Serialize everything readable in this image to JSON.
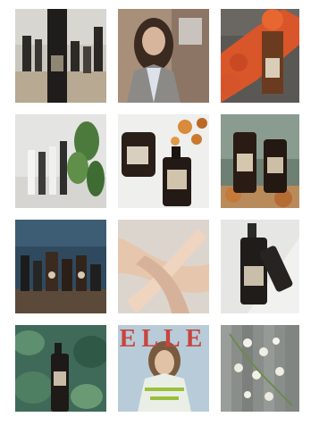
{
  "grid": {
    "tiles": [
      {
        "alt": "oil-bottles-shop-shelf"
      },
      {
        "alt": "woman-portrait"
      },
      {
        "alt": "bottle-with-orange-flowers"
      },
      {
        "alt": "tubes-and-green-leaves"
      },
      {
        "alt": "bottles-with-dried-flowers"
      },
      {
        "alt": "bottles-on-table"
      },
      {
        "alt": "product-display-stand"
      },
      {
        "alt": "hands-with-silk-ribbon"
      },
      {
        "alt": "dark-pump-bottle"
      },
      {
        "alt": "spray-bottle-on-plants"
      },
      {
        "alt": "magazine-cover",
        "text": "ELLE"
      },
      {
        "alt": "white-flowers-on-wood"
      }
    ]
  }
}
